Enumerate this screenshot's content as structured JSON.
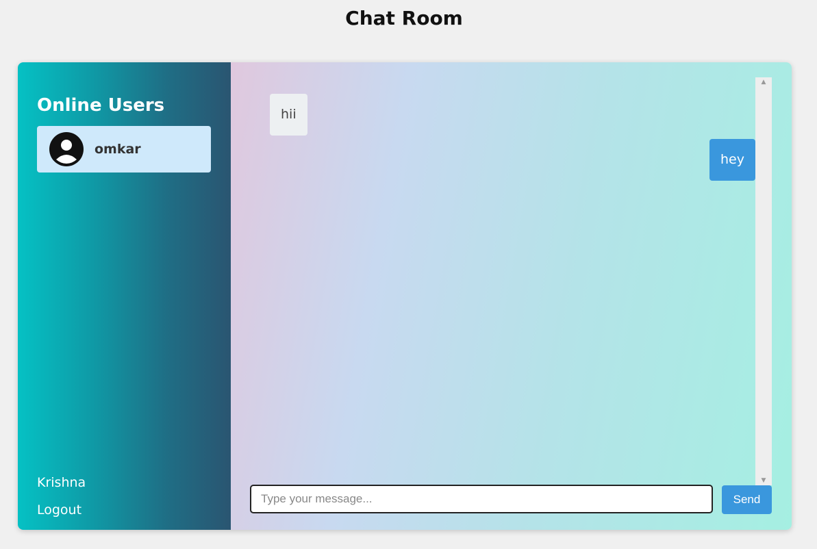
{
  "page": {
    "title": "Chat Room"
  },
  "sidebar": {
    "title": "Online Users",
    "users": [
      {
        "name": "omkar",
        "icon": "user-avatar-icon"
      }
    ],
    "current_user": "Krishna",
    "logout_label": "Logout",
    "gradient_colors": [
      "#05c1c4",
      "#2a5571"
    ]
  },
  "chat": {
    "messages": [
      {
        "text": "hii",
        "direction": "received"
      },
      {
        "text": "hey",
        "direction": "sent"
      }
    ],
    "input": {
      "value": "",
      "placeholder": "Type your message..."
    },
    "send_label": "Send",
    "accent_color": "#3a97dd"
  }
}
